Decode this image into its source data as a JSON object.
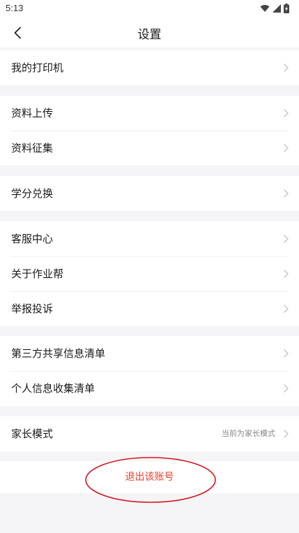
{
  "status_bar": {
    "time": "5:13",
    "icons": [
      "wifi-icon",
      "cellular-signal-icon",
      "battery-charging-icon"
    ]
  },
  "nav": {
    "title": "设置",
    "back_icon": "chevron-left-icon"
  },
  "groups": [
    {
      "items": [
        {
          "label": "我的打印机"
        }
      ]
    },
    {
      "items": [
        {
          "label": "资料上传"
        },
        {
          "label": "资料征集"
        }
      ]
    },
    {
      "items": [
        {
          "label": "学分兑换"
        }
      ]
    },
    {
      "items": [
        {
          "label": "客服中心"
        },
        {
          "label": "关于作业帮"
        },
        {
          "label": "举报投诉"
        }
      ]
    },
    {
      "items": [
        {
          "label": "第三方共享信息清单"
        },
        {
          "label": "个人信息收集清单"
        }
      ]
    },
    {
      "items": [
        {
          "label": "家长模式",
          "value": "当前为家长模式"
        }
      ]
    }
  ],
  "logout": {
    "label": "退出该账号",
    "color": "#e8412e"
  },
  "annotation": {
    "color": "#d4141c"
  }
}
